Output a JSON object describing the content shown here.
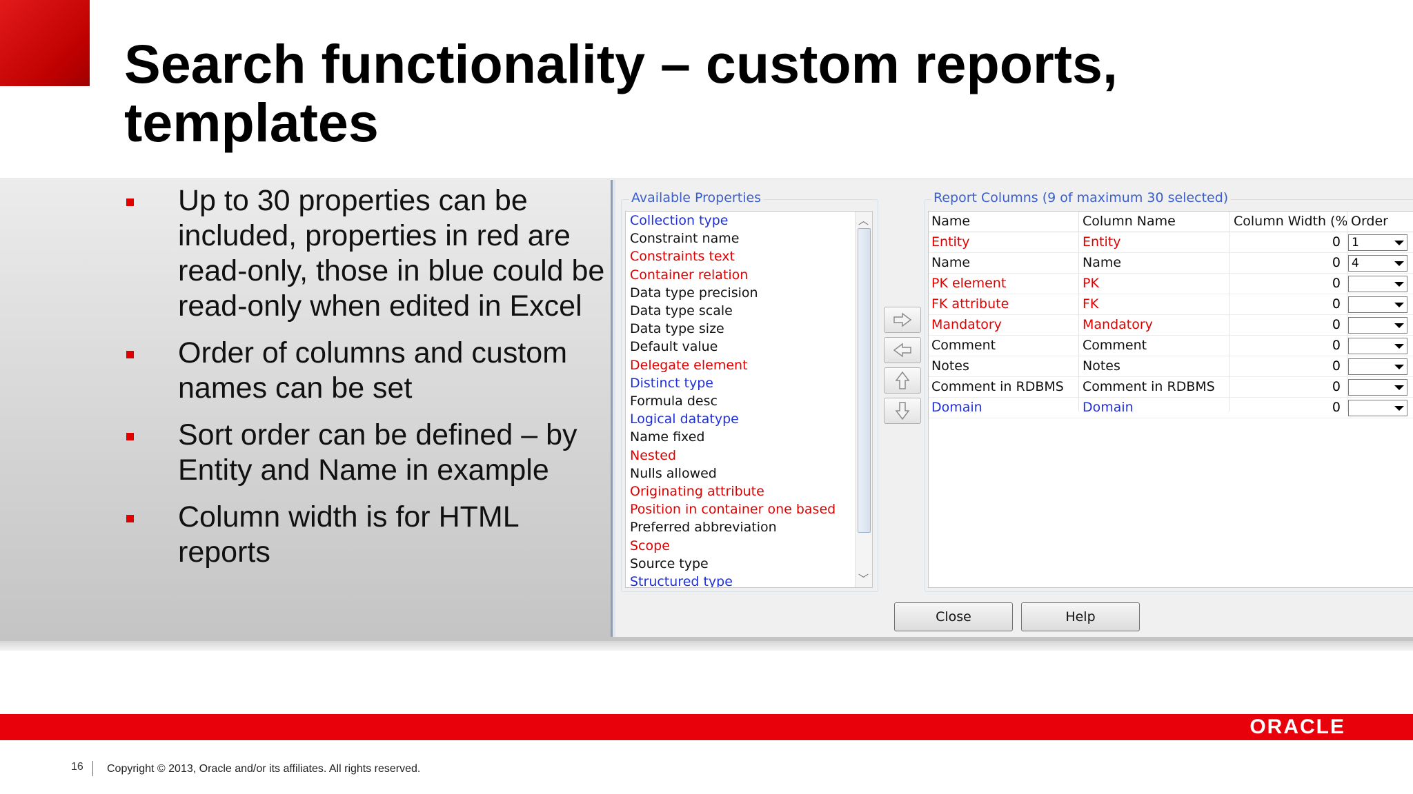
{
  "slide": {
    "title_line1": "Search functionality – custom reports,",
    "title_line2": "templates",
    "bullets": [
      "Up to 30 properties can be included, properties in red are read-only, those in blue could be read-only when edited in Excel",
      "Order of columns and custom names can be set",
      "Sort order can be defined – by Entity and Name in example",
      "Column width is for HTML reports"
    ],
    "page_number": "16",
    "copyright": "Copyright © 2013, Oracle and/or its affiliates. All rights reserved.",
    "logo_text": "ORACLE"
  },
  "colors": {
    "red": "#e00000",
    "blue": "#2030d8",
    "black": "#111111",
    "oracle_red": "#e8000a"
  },
  "dialog": {
    "available_label": "Available Properties",
    "available": [
      {
        "text": "Collection type",
        "color": "blue"
      },
      {
        "text": "Constraint name",
        "color": "black"
      },
      {
        "text": "Constraints text",
        "color": "red"
      },
      {
        "text": "Container relation",
        "color": "red"
      },
      {
        "text": "Data type precision",
        "color": "black"
      },
      {
        "text": "Data type scale",
        "color": "black"
      },
      {
        "text": "Data type size",
        "color": "black"
      },
      {
        "text": "Default value",
        "color": "black"
      },
      {
        "text": "Delegate element",
        "color": "red"
      },
      {
        "text": "Distinct type",
        "color": "blue"
      },
      {
        "text": "Formula desc",
        "color": "black"
      },
      {
        "text": "Logical datatype",
        "color": "blue"
      },
      {
        "text": "Name fixed",
        "color": "black"
      },
      {
        "text": "Nested",
        "color": "red"
      },
      {
        "text": "Nulls allowed",
        "color": "black"
      },
      {
        "text": "Originating attribute",
        "color": "red"
      },
      {
        "text": "Position in container one based",
        "color": "red"
      },
      {
        "text": "Preferred abbreviation",
        "color": "black"
      },
      {
        "text": "Scope",
        "color": "red"
      },
      {
        "text": "Source type",
        "color": "black"
      },
      {
        "text": "Structured type",
        "color": "blue"
      }
    ],
    "report_label": "Report Columns (9 of maximum 30 selected)",
    "headers": [
      "Name",
      "Column Name",
      "Column Width (%)",
      "Order"
    ],
    "rows": [
      {
        "name": "Entity",
        "column": "Entity",
        "width": "0",
        "order": "1",
        "color": "red"
      },
      {
        "name": "Name",
        "column": "Name",
        "width": "0",
        "order": "4",
        "color": "black"
      },
      {
        "name": "PK element",
        "column": "PK",
        "width": "0",
        "order": "",
        "color": "red"
      },
      {
        "name": "FK attribute",
        "column": "FK",
        "width": "0",
        "order": "",
        "color": "red"
      },
      {
        "name": "Mandatory",
        "column": "Mandatory",
        "width": "0",
        "order": "",
        "color": "red"
      },
      {
        "name": "Comment",
        "column": "Comment",
        "width": "0",
        "order": "",
        "color": "black"
      },
      {
        "name": "Notes",
        "column": "Notes",
        "width": "0",
        "order": "",
        "color": "black"
      },
      {
        "name": "Comment in RDBMS",
        "column": "Comment in RDBMS",
        "width": "0",
        "order": "",
        "color": "black"
      },
      {
        "name": "Domain",
        "column": "Domain",
        "width": "0",
        "order": "",
        "color": "blue"
      }
    ],
    "arrow_icons": [
      "right-arrow-icon",
      "left-arrow-icon",
      "up-arrow-icon",
      "down-arrow-icon"
    ],
    "close_label": "Close",
    "help_label": "Help"
  }
}
